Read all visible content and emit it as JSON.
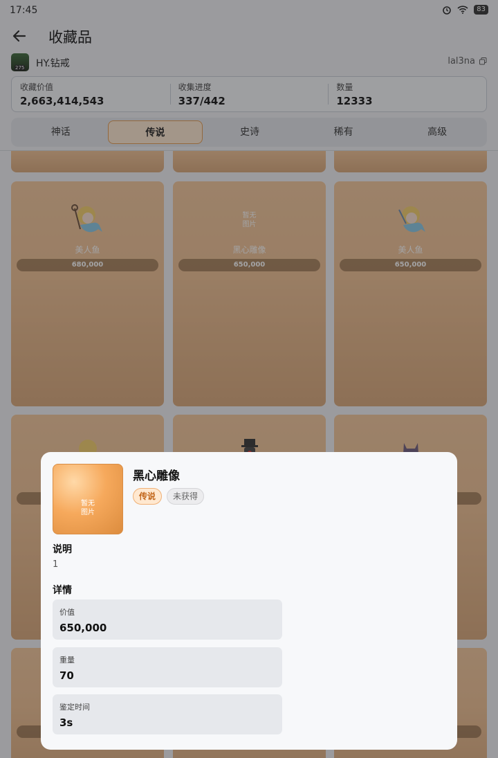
{
  "status_bar": {
    "time": "17:45",
    "battery": "83"
  },
  "header": {
    "title": "收藏品"
  },
  "user": {
    "name": "HY.钻戒",
    "level": "275",
    "id": "lal3na"
  },
  "stats": [
    {
      "label": "收藏价值",
      "value": "2,663,414,543"
    },
    {
      "label": "收集进度",
      "value": "337/442"
    },
    {
      "label": "数量",
      "value": "12333"
    }
  ],
  "tabs": [
    {
      "label": "神话",
      "active": false
    },
    {
      "label": "传说",
      "active": true
    },
    {
      "label": "史诗",
      "active": false
    },
    {
      "label": "稀有",
      "active": false
    },
    {
      "label": "高级",
      "active": false
    }
  ],
  "cards": [
    {
      "name": "美人鱼",
      "price": "680,000",
      "image": "mermaid-icon"
    },
    {
      "name": "黑心雕像",
      "price": "650,000",
      "image": "placeholder",
      "placeholder": "暂无\n图片"
    },
    {
      "name": "美人鱼",
      "price": "650,000",
      "image": "mermaid-icon"
    }
  ],
  "dialog": {
    "title": "黑心雕像",
    "placeholder": "暂无\n图片",
    "rarity_badge": "传说",
    "status_badge": "未获得",
    "desc_heading": "说明",
    "desc": "1",
    "details_heading": "详情",
    "details": [
      {
        "label": "价值",
        "value": "650,000"
      },
      {
        "label": "重量",
        "value": "70"
      },
      {
        "label": "鉴定时间",
        "value": "3s"
      }
    ]
  }
}
